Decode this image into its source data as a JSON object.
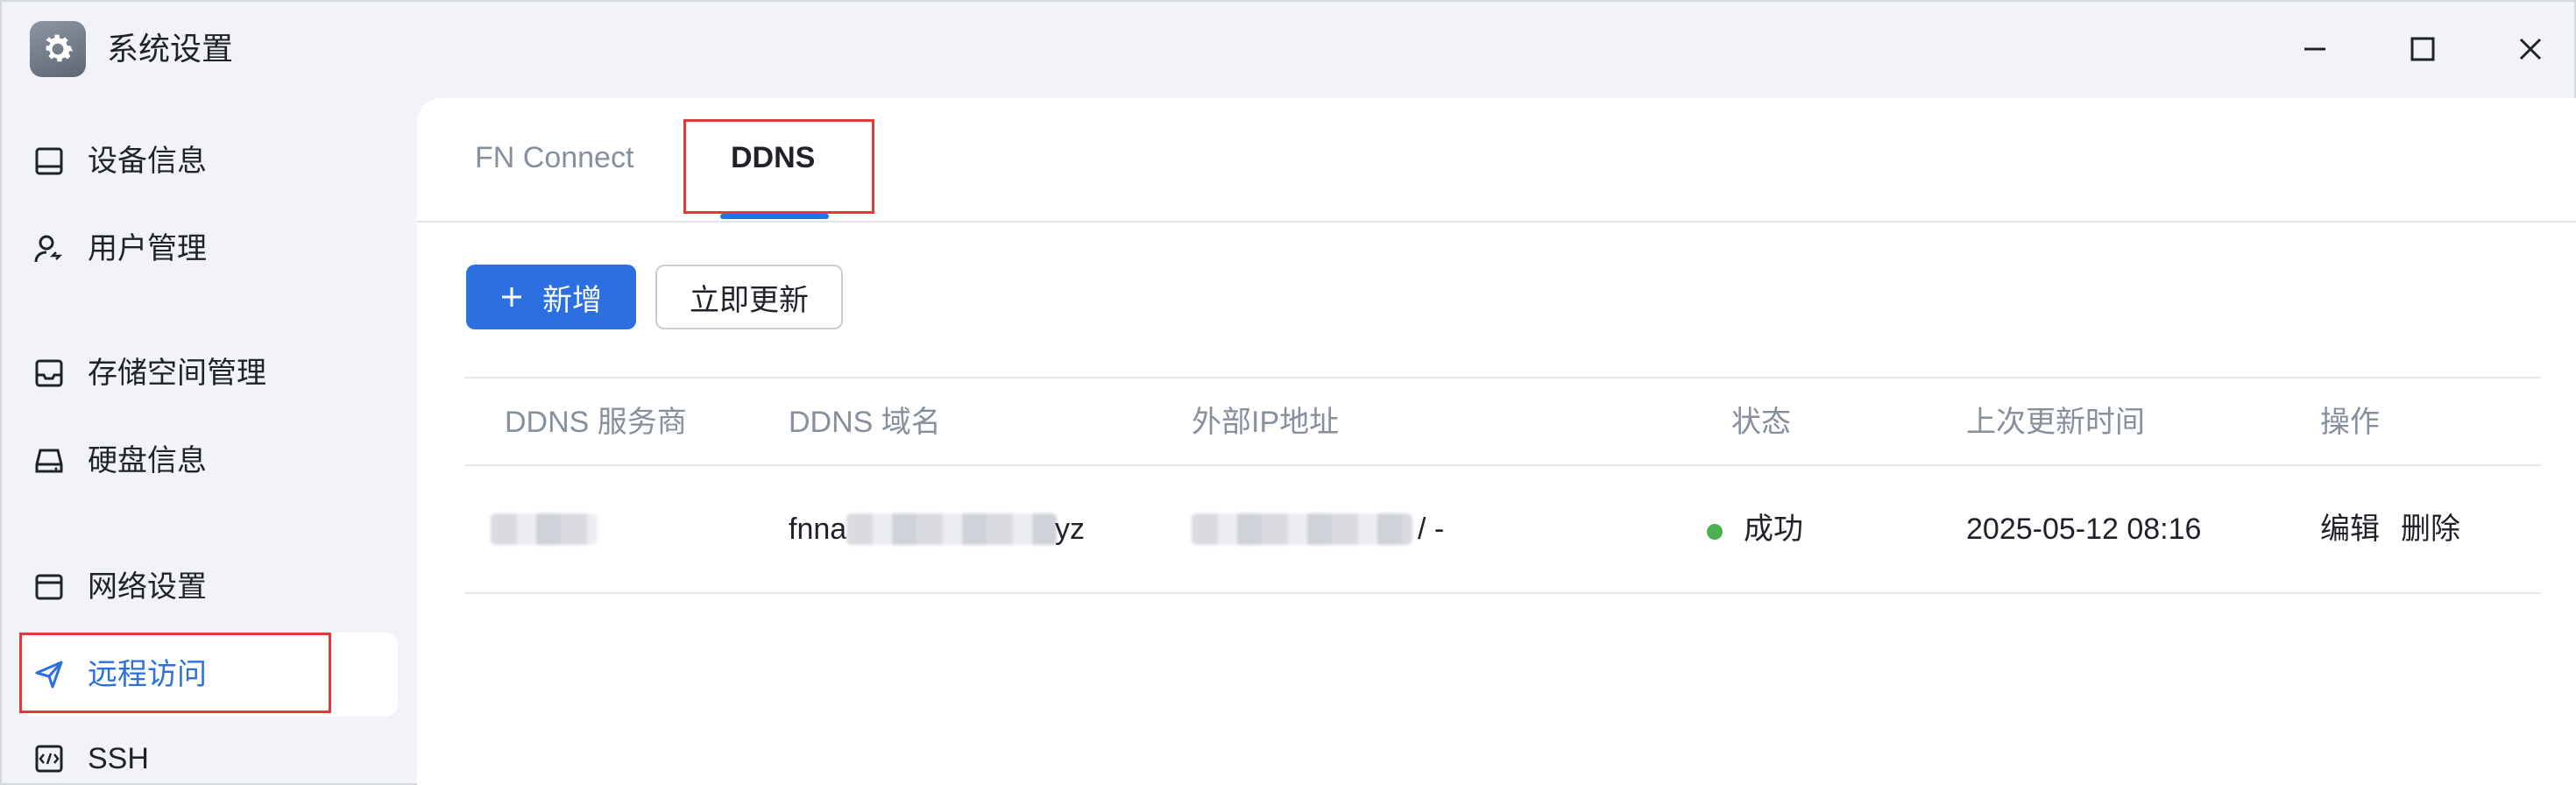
{
  "window": {
    "title": "系统设置",
    "icons": {
      "app": "gear-icon",
      "minimize": "minimize-icon",
      "maximize": "maximize-icon",
      "close": "close-icon"
    }
  },
  "sidebar": {
    "items": [
      {
        "label": "设备信息",
        "icon": "monitor-icon",
        "active": false
      },
      {
        "label": "用户管理",
        "icon": "user-icon",
        "active": false
      },
      {
        "label": "存储空间管理",
        "icon": "inbox-tray-icon",
        "active": false
      },
      {
        "label": "硬盘信息",
        "icon": "hard-drive-icon",
        "active": false
      },
      {
        "label": "网络设置",
        "icon": "browser-window-icon",
        "active": false
      },
      {
        "label": "远程访问",
        "icon": "send-arrow-icon",
        "active": true
      },
      {
        "label": "SSH",
        "icon": "code-terminal-icon",
        "active": false
      }
    ]
  },
  "tabs": [
    {
      "label": "FN Connect",
      "active": false
    },
    {
      "label": "DDNS",
      "active": true
    }
  ],
  "toolbar": {
    "add_label": "新增",
    "add_icon": "plus-icon",
    "update_label": "立即更新"
  },
  "table": {
    "headers": [
      "DDNS 服务商",
      "DDNS 域名",
      "外部IP地址",
      "状态",
      "上次更新时间",
      "操作"
    ],
    "rows": [
      {
        "domain_prefix": "fnna",
        "domain_suffix": "yz",
        "ip_suffix": "/ -",
        "status": "成功",
        "updated": "2025-05-12 08:16",
        "actions": [
          "编辑",
          "删除"
        ]
      }
    ]
  },
  "colors": {
    "accent": "#2b6fe0",
    "success": "#4caf50",
    "highlight_box": "#e53935",
    "background": "#f2f3f7"
  }
}
